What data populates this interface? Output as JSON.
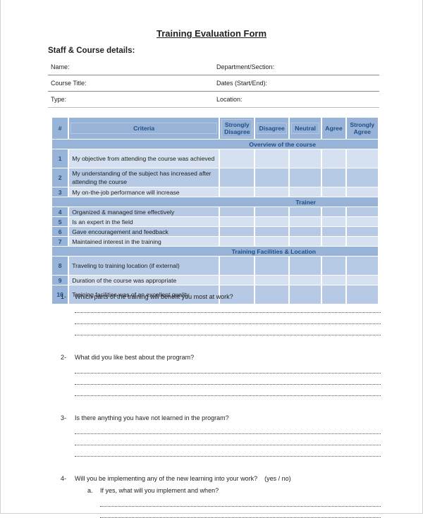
{
  "title": "Training Evaluation Form",
  "details": {
    "heading": "Staff & Course details:",
    "rows": [
      [
        "Name:",
        "Department/Section:"
      ],
      [
        "Course Title:",
        "Dates (Start/End):"
      ],
      [
        "Type:",
        "Location:"
      ]
    ]
  },
  "table": {
    "headers": [
      "#",
      "Criteria",
      "Strongly Disagree",
      "Disagree",
      "Neutral",
      "Agree",
      "Strongly Agree"
    ],
    "sections": [
      {
        "title": "Overview of the course",
        "rows": [
          {
            "num": "1",
            "text": "My objective from attending the course was achieved"
          },
          {
            "num": "2",
            "text": "My understanding of the subject has increased after attending the course"
          },
          {
            "num": "3",
            "text": "My on-the-job performance will increase"
          }
        ]
      },
      {
        "title": "Trainer",
        "rows": [
          {
            "num": "4",
            "text": "Organized & managed time effectively"
          },
          {
            "num": "5",
            "text": "Is an expert in the field"
          },
          {
            "num": "6",
            "text": "Gave encouragement and feedback"
          },
          {
            "num": "7",
            "text": "Maintained interest in the training"
          }
        ]
      },
      {
        "title": "Training Facilities & Location",
        "rows": [
          {
            "num": "8",
            "text": "Traveling to training location (if external)"
          },
          {
            "num": "9",
            "text": "Duration of the course was appropriate"
          },
          {
            "num": "10",
            "text": "Training facilities was of an excellent quality"
          }
        ]
      }
    ]
  },
  "questions": [
    {
      "num": "1-",
      "text": "Which parts of the training will benefit you most at work?",
      "lines": 3
    },
    {
      "num": "2-",
      "text": "What did you like best about the program?",
      "lines": 3
    },
    {
      "num": "3-",
      "text": "Is there anything you have not learned in the program?",
      "lines": 3
    },
    {
      "num": "4-",
      "text": "Will you be implementing any of the new learning into your work?    (yes / no)",
      "lines": 0,
      "sub": {
        "num": "a.",
        "text": "If yes, what will you implement and when?",
        "lines": 2
      }
    }
  ],
  "colors": {
    "header_bg": "#98b3d8",
    "row_light": "#d5e0f0",
    "row_dark": "#b7cae5",
    "header_text": "#1f4e86"
  }
}
